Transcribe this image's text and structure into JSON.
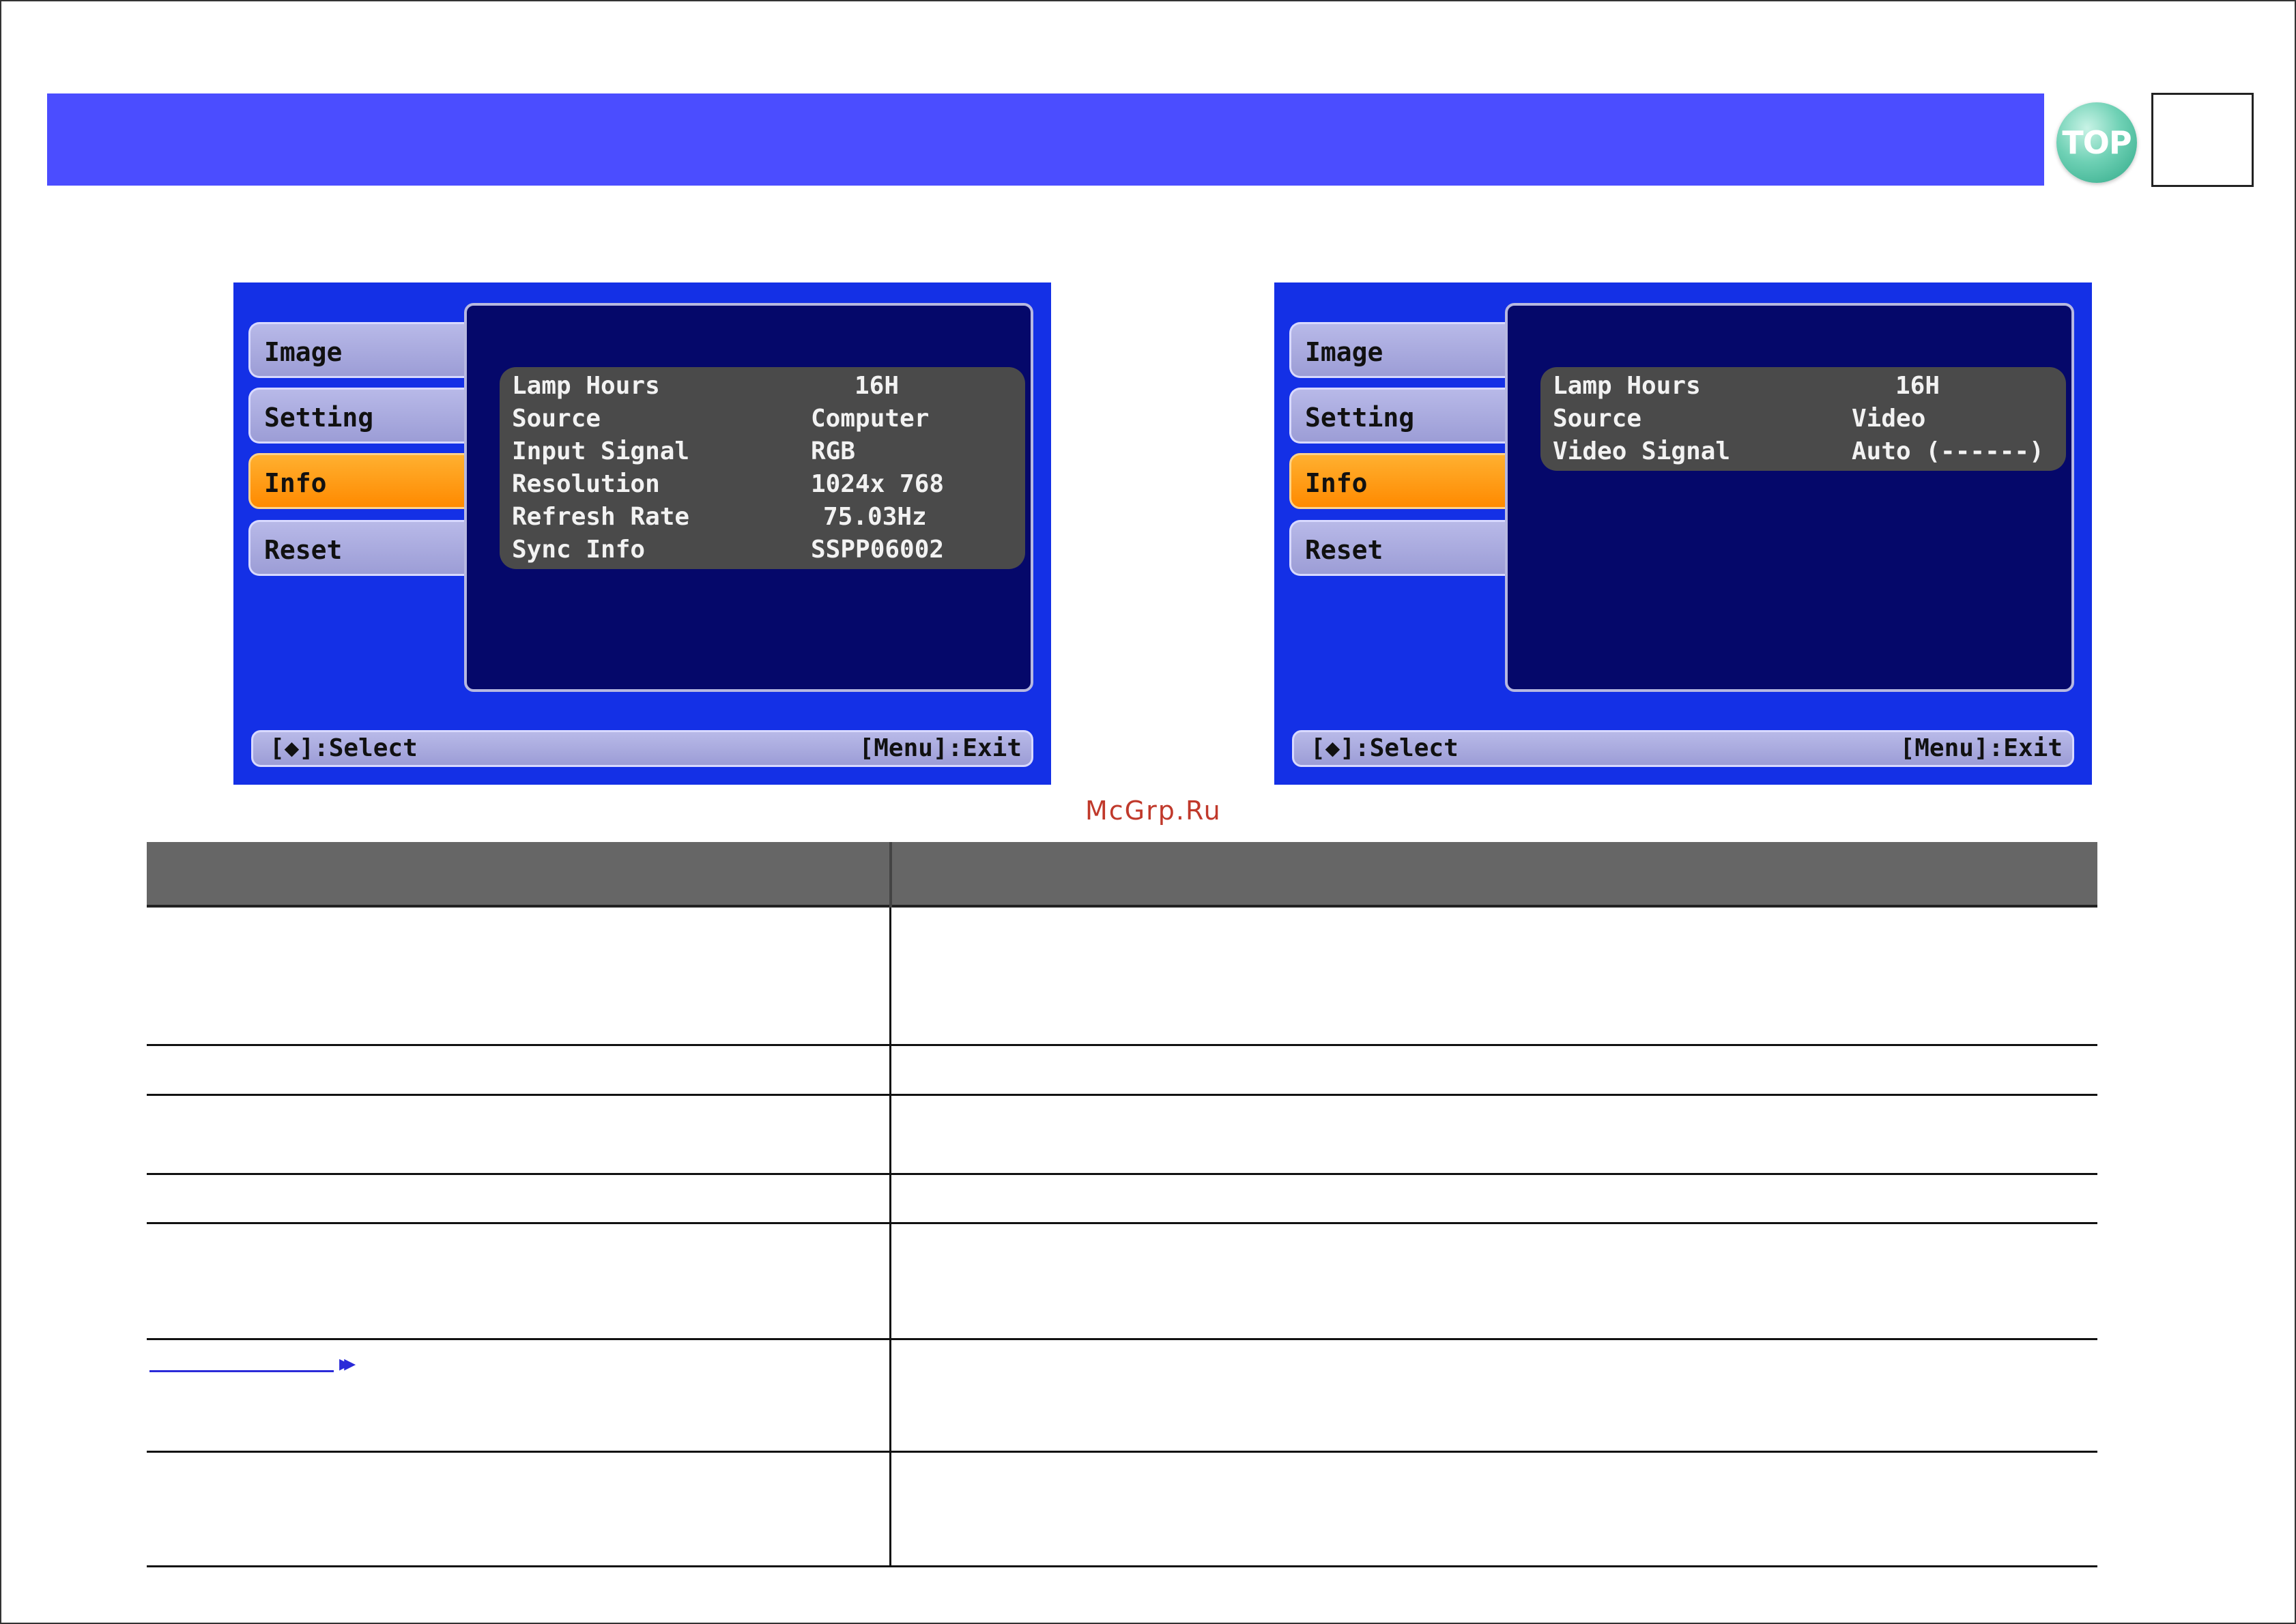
{
  "header": {
    "top_button_label": "TOP"
  },
  "osd_left": {
    "tabs": [
      "Image",
      "Setting",
      "Info",
      "Reset"
    ],
    "active_tab": "Info",
    "rows": [
      {
        "key": "Lamp Hours",
        "value": "16H"
      },
      {
        "key": "Source",
        "value": "Computer"
      },
      {
        "key": "Input Signal",
        "value": "RGB"
      },
      {
        "key": "Resolution",
        "value": "1024x 768"
      },
      {
        "key": "Refresh Rate",
        "value": "75.03Hz"
      },
      {
        "key": "Sync Info",
        "value": "SSPP06002"
      }
    ],
    "status_select": "[◆]:Select",
    "status_exit": "[Menu]:Exit"
  },
  "osd_right": {
    "tabs": [
      "Image",
      "Setting",
      "Info",
      "Reset"
    ],
    "active_tab": "Info",
    "rows": [
      {
        "key": "Lamp Hours",
        "value": "16H"
      },
      {
        "key": "Source",
        "value": "Video"
      },
      {
        "key": "Video Signal",
        "value": "Auto (------)"
      }
    ],
    "status_select": "[◆]:Select",
    "status_exit": "[Menu]:Exit"
  },
  "watermark": "McGrp.Ru",
  "colors": {
    "header_bar": "#4b4dff",
    "osd_background": "#1430e6",
    "osd_panel": "#05086a",
    "active_tab": "#ff8a00",
    "table_header": "#666666",
    "link": "#2a2ad8"
  },
  "icons": {
    "top_button": "top-icon",
    "link_arrow": "double-chevron-right-icon"
  }
}
